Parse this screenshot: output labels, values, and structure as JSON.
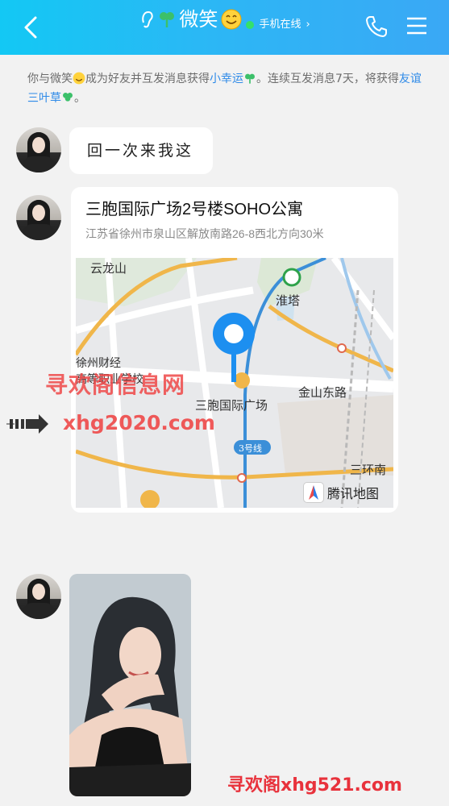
{
  "header": {
    "title": "微笑",
    "status": "手机在线",
    "colors": {
      "bg_start": "#13c8f4",
      "bg_end": "#3aa8f5",
      "online_dot": "#35e06a"
    }
  },
  "notice": {
    "part1": "你与微笑",
    "part2": "成为好友并互发消息获得",
    "highlight1": "小幸运",
    "part3": "。连续互发消息7天，将获得",
    "highlight2": "友谊三叶草",
    "part4": "。"
  },
  "messages": [
    {
      "type": "text",
      "text": "回一次来我这"
    },
    {
      "type": "location",
      "title": "三胞国际广场2号楼SOHO公寓",
      "address": "江苏省徐州市泉山区解放南路26-8西北方向30米",
      "map": {
        "labels": {
          "yunlongshan": "云龙山",
          "huaita": "淮塔",
          "caijing": "徐州财经",
          "caijing2": "高等职业学校",
          "sanbao": "三胞国际广场",
          "jinshan": "金山东路",
          "line3": "3号线",
          "sanhuan": "三环南"
        },
        "brand": "腾讯地图"
      }
    },
    {
      "type": "image"
    }
  ],
  "watermarks": {
    "site_cn": "寻欢阁信息网",
    "site_url": "xhg2020.com",
    "bottom": "寻欢阁xhg521.com"
  }
}
